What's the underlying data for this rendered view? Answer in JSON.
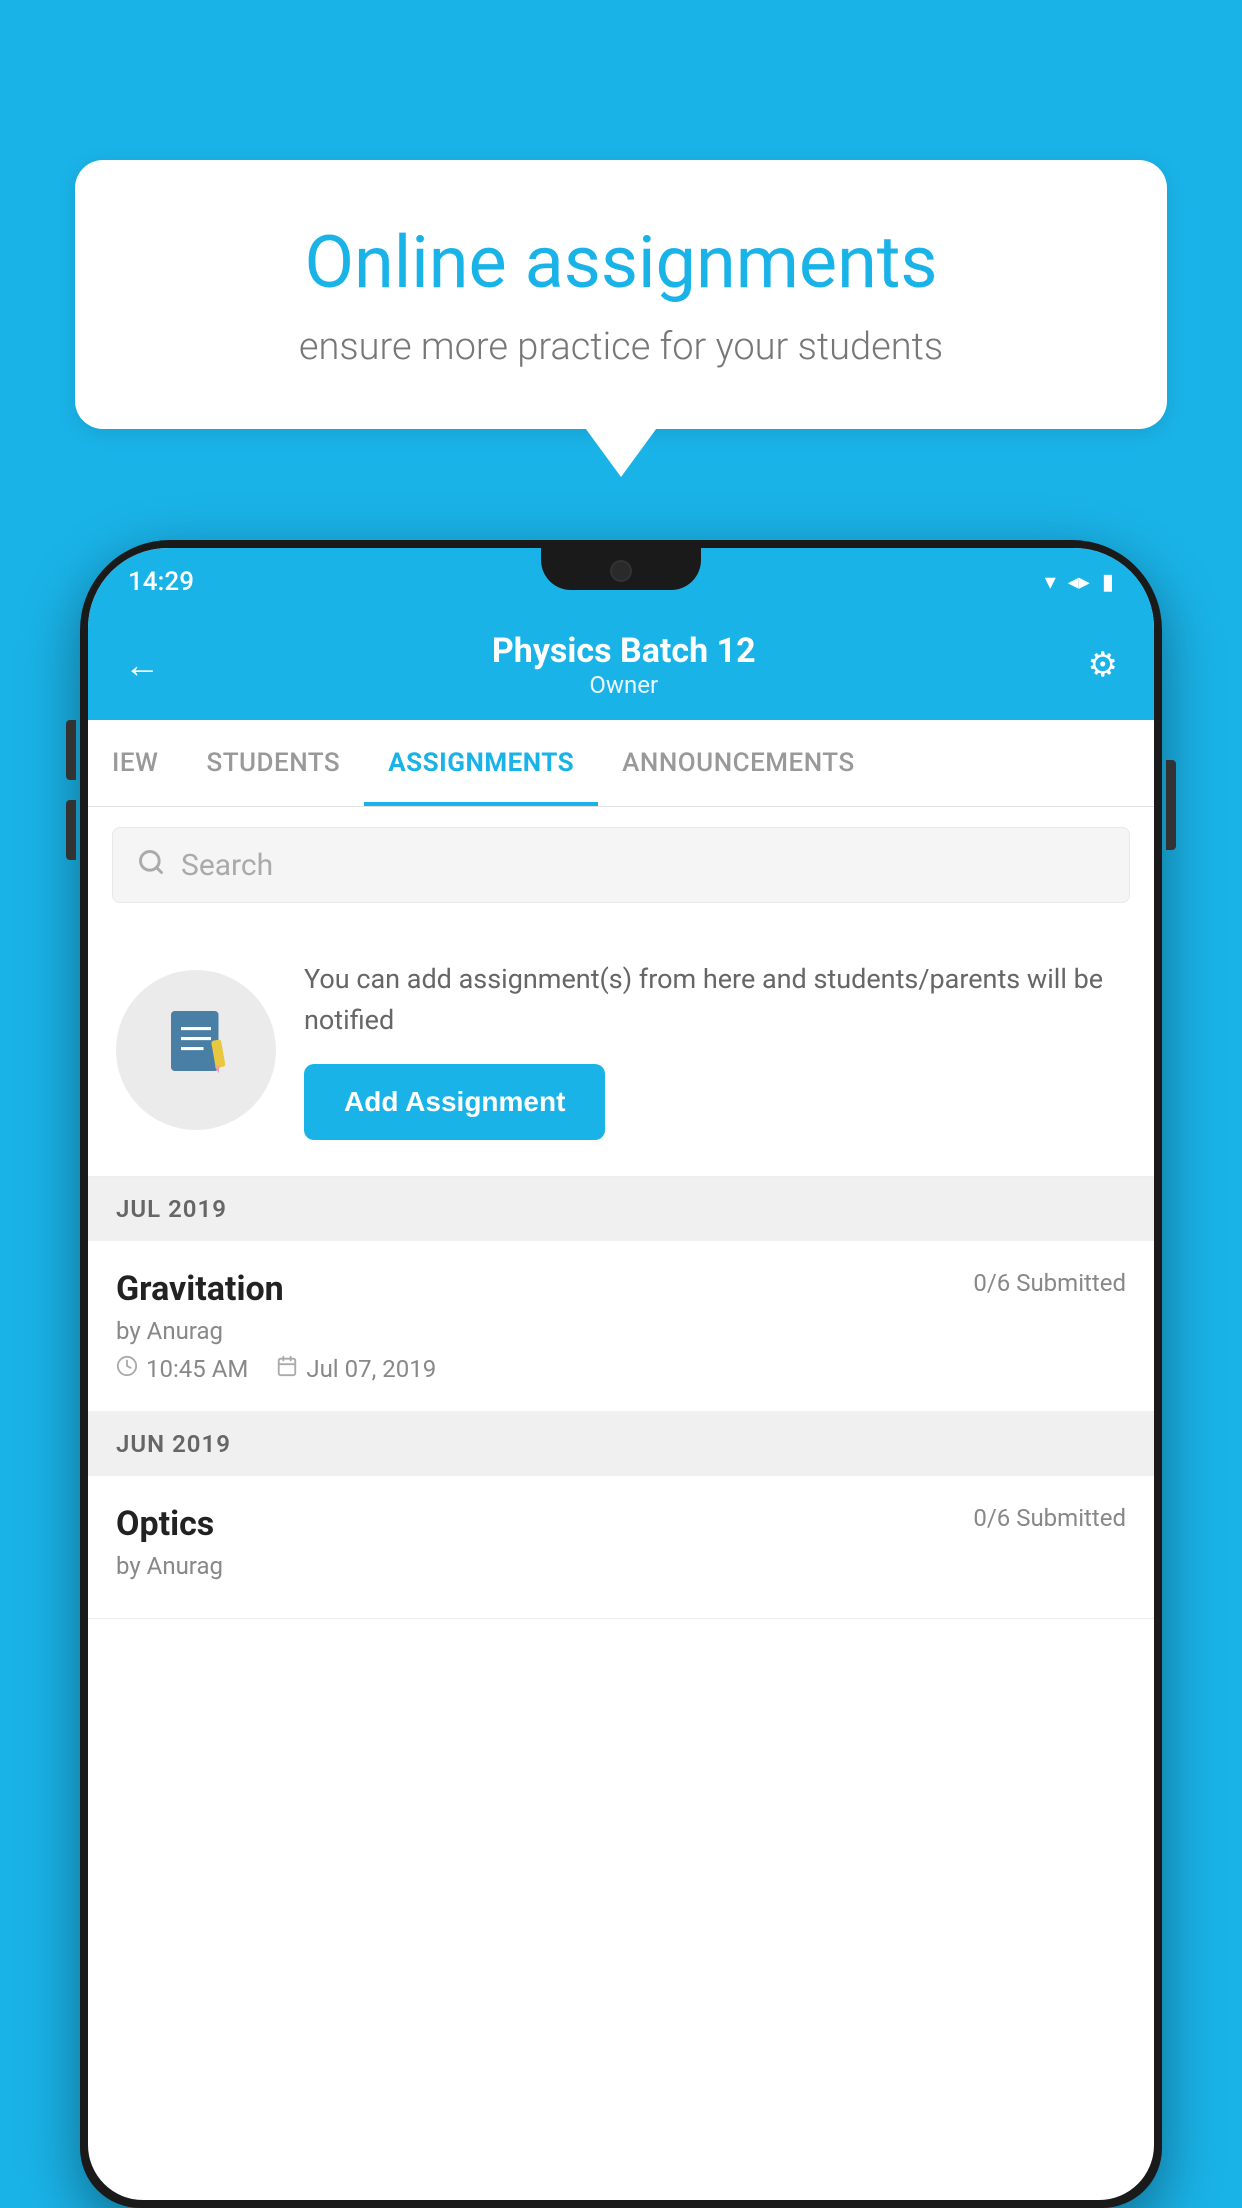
{
  "background": {
    "color": "#1ab3e8"
  },
  "speech_bubble": {
    "title": "Online assignments",
    "subtitle": "ensure more practice for your students"
  },
  "status_bar": {
    "time": "14:29",
    "wifi_icon": "▾",
    "signal_icon": "▲",
    "battery_icon": "▮"
  },
  "header": {
    "title": "Physics Batch 12",
    "subtitle": "Owner",
    "back_label": "←",
    "settings_label": "⚙"
  },
  "tabs": [
    {
      "label": "IEW",
      "active": false
    },
    {
      "label": "STUDENTS",
      "active": false
    },
    {
      "label": "ASSIGNMENTS",
      "active": true
    },
    {
      "label": "ANNOUNCEMENTS",
      "active": false
    }
  ],
  "search": {
    "placeholder": "Search"
  },
  "promo": {
    "description": "You can add assignment(s) from here and students/parents will be notified",
    "button_label": "Add Assignment"
  },
  "sections": [
    {
      "month": "JUL 2019",
      "assignments": [
        {
          "name": "Gravitation",
          "submitted": "0/6 Submitted",
          "author": "by Anurag",
          "time": "10:45 AM",
          "date": "Jul 07, 2019"
        }
      ]
    },
    {
      "month": "JUN 2019",
      "assignments": [
        {
          "name": "Optics",
          "submitted": "0/6 Submitted",
          "author": "by Anurag",
          "time": "",
          "date": ""
        }
      ]
    }
  ]
}
